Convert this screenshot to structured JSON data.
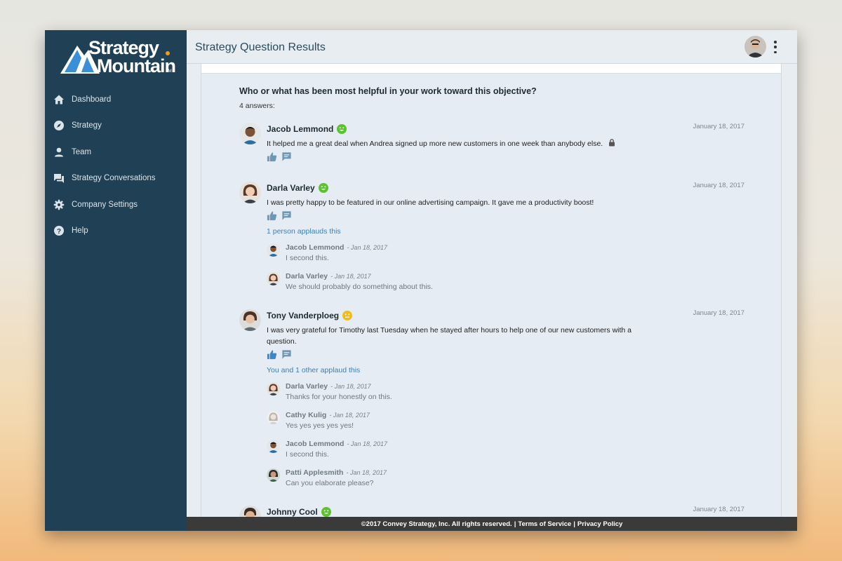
{
  "brand": {
    "word1": "Strategy",
    "word2": "Mountain",
    "tm": "TM"
  },
  "nav": [
    {
      "label": "Dashboard",
      "icon": "home-icon"
    },
    {
      "label": "Strategy",
      "icon": "compass-icon"
    },
    {
      "label": "Team",
      "icon": "person-icon"
    },
    {
      "label": "Strategy Conversations",
      "icon": "chat-icon"
    },
    {
      "label": "Company Settings",
      "icon": "gear-icon"
    },
    {
      "label": "Help",
      "icon": "help-icon"
    }
  ],
  "header": {
    "title": "Strategy Question Results"
  },
  "question": {
    "text": "Who or what has been most helpful in your work toward this objective?",
    "count": "4 answers:"
  },
  "answers": [
    {
      "name": "Jacob Lemmond",
      "mood": "happy",
      "date": "January 18, 2017",
      "text": "It helped me a great deal when Andrea signed up more new customers in one week than anybody else."
    },
    {
      "name": "Darla Varley",
      "mood": "happy",
      "date": "January 18, 2017",
      "text": "I was pretty happy to be featured in our online advertising campaign. It gave me a productivity boost!",
      "applaud": "1 person applauds this",
      "comments": [
        {
          "name": "Jacob Lemmond",
          "date": "- Jan 18, 2017",
          "text": "I second this."
        },
        {
          "name": "Darla Varley",
          "date": "- Jan 18, 2017",
          "text": "We should probably do something about this."
        }
      ]
    },
    {
      "name": "Tony Vanderploeg",
      "mood": "neutral",
      "date": "January 18, 2017",
      "text": "I was very grateful for Timothy last Tuesday when he stayed after hours to help one of our new customers with a question.",
      "applaud": "You and 1 other applaud this",
      "comments": [
        {
          "name": "Darla Varley",
          "date": "- Jan 18, 2017",
          "text": "Thanks for your honestly on this."
        },
        {
          "name": "Cathy Kulig",
          "date": "- Jan 18, 2017",
          "text": "Yes yes yes yes yes!"
        },
        {
          "name": "Jacob Lemmond",
          "date": "- Jan 18, 2017",
          "text": "I second this."
        },
        {
          "name": "Patti Applesmith",
          "date": "- Jan 18, 2017",
          "text": "Can you elaborate please?"
        }
      ]
    },
    {
      "name": "Johnny Cool",
      "mood": "happy",
      "date": "January 18, 2017"
    }
  ],
  "footer": {
    "copyright": "©2017 Convey Strategy, Inc. All rights reserved.",
    "sep": "|",
    "terms": "Terms of Service",
    "privacy": "Privacy Policy"
  },
  "colors": {
    "sidebar": "#204155",
    "link": "#3d7fb5",
    "happy": "#5cc22f",
    "neutral": "#f0bd1a",
    "logo_blue": "#3a8fd8",
    "logo_orange": "#f29a1f"
  }
}
